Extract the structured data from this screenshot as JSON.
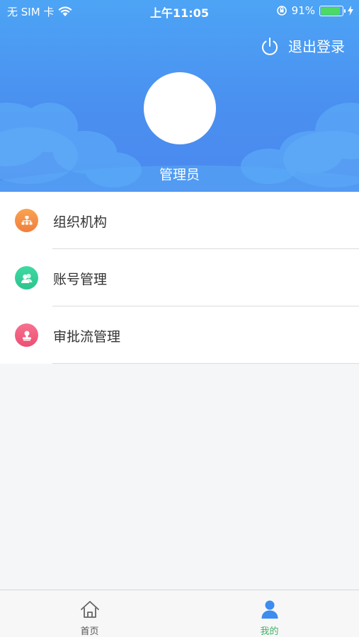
{
  "status_bar": {
    "carrier": "无 SIM 卡",
    "time": "上午11:05",
    "battery_percent": "91%",
    "battery_level": 0.91,
    "wifi_icon": "wifi-icon",
    "rotation_lock_icon": "rotation-lock-icon",
    "charging_icon": "charging-bolt-icon"
  },
  "header": {
    "logout_label": "退出登录",
    "logout_icon": "power-icon",
    "username": "管理员",
    "gradient_top": "#4da4f5",
    "gradient_bottom": "#4b88ee"
  },
  "menu": {
    "items": [
      {
        "label": "组织机构",
        "icon": "organization-icon",
        "color_start": "#f9a352",
        "color_end": "#f07f3c"
      },
      {
        "label": "账号管理",
        "icon": "account-users-icon",
        "color_start": "#3fd9a4",
        "color_end": "#2cc48d"
      },
      {
        "label": "审批流管理",
        "icon": "approval-stamp-icon",
        "color_start": "#f7718f",
        "color_end": "#ec4f74"
      }
    ]
  },
  "tabbar": {
    "tabs": [
      {
        "label": "首页",
        "icon": "home-icon",
        "active": false,
        "color": "#555555"
      },
      {
        "label": "我的",
        "icon": "user-icon",
        "active": true,
        "color": "#3d8cf0"
      }
    ],
    "active_label_color": "#44b06a"
  }
}
